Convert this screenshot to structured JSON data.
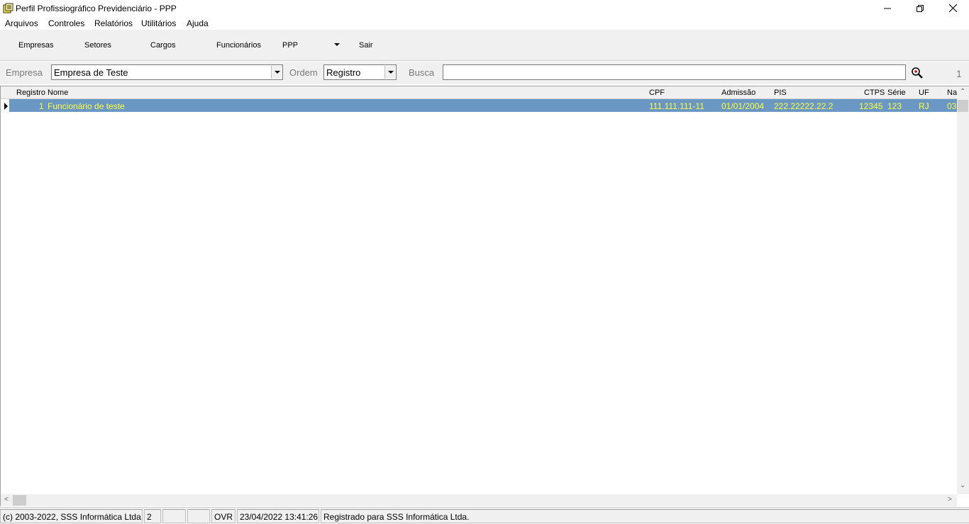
{
  "window": {
    "title": "Perfil Profissiográfico Previdenciário - PPP",
    "icon": "app-icon",
    "controls": {
      "minimize": "minimize-icon",
      "maximize": "restore-icon",
      "close": "close-icon"
    }
  },
  "menu": {
    "items": [
      "Arquivos",
      "Controles",
      "Relatórios",
      "Utilitários",
      "Ajuda"
    ]
  },
  "toolbar": {
    "buttons": [
      "Empresas",
      "Setores",
      "Cargos",
      "Funcionários",
      "PPP",
      "Sair"
    ]
  },
  "filter": {
    "empresa_label": "Empresa",
    "empresa_value": "Empresa de Teste",
    "ordem_label": "Ordem",
    "ordem_value": "Registro",
    "busca_label": "Busca",
    "busca_value": "",
    "record_count": "1"
  },
  "grid": {
    "columns": [
      "Registro",
      "Nome",
      "CPF",
      "Admissão",
      "PIS",
      "CTPS",
      "Série",
      "UF",
      "Na"
    ],
    "rows": [
      {
        "registro": "1",
        "nome": "Funcionário de teste",
        "cpf": "111.111.111-11",
        "admissao": "01/01/2004",
        "pis": "222.22222.22.2",
        "ctps": "12345",
        "serie": "123",
        "uf": "RJ",
        "na": "03"
      }
    ],
    "selected_row_color": "#6a97c4",
    "selected_text_color": "#ffff40"
  },
  "status": {
    "copyright": "(c) 2003-2022, SSS Informática Ltda.",
    "panel2": "2",
    "panel3": "",
    "panel4": "",
    "mode": "OVR",
    "datetime": "23/04/2022 13:41:26",
    "registered": "Registrado para SSS Informática Ltda."
  }
}
